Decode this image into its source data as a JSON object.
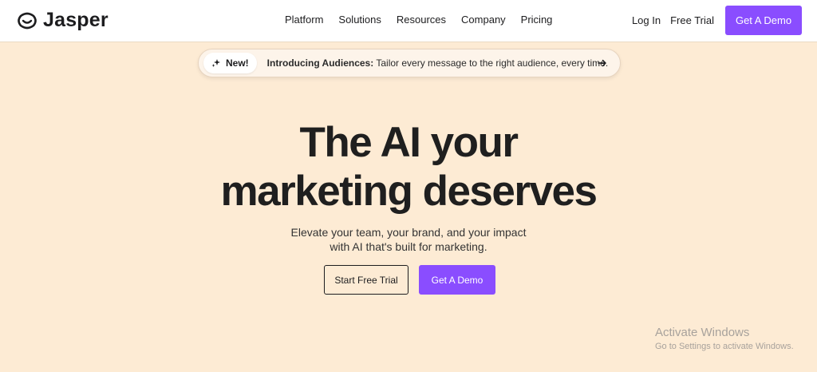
{
  "brand": {
    "name": "Jasper",
    "logo_icon": "smile-face-icon",
    "text_color": "#1d1d1f"
  },
  "nav": {
    "links": [
      "Platform",
      "Solutions",
      "Resources",
      "Company",
      "Pricing"
    ],
    "login_label": "Log In",
    "free_trial_label": "Free Trial",
    "demo_label": "Get A Demo"
  },
  "announcement": {
    "badge_label": "New!",
    "badge_icon": "sparkle-icon",
    "headline": "Introducing Audiences:",
    "text": "Tailor every message to the right audience, every time.",
    "arrow_icon": "arrow-right-icon"
  },
  "hero": {
    "title_line1": "The AI your",
    "title_line2": "marketing deserves",
    "subtitle_line1": "Elevate your team, your brand, and your impact",
    "subtitle_line2": "with AI that's built for marketing.",
    "free_trial_button": "Start Free Trial",
    "demo_button": "Get A Demo"
  },
  "watermark": {
    "title": "Activate Windows",
    "subtitle": "Go to Settings to activate Windows."
  },
  "colors": {
    "accent": "#8a4dff",
    "background": "#fdebd4",
    "navbar": "#ffffff",
    "text": "#1d1d1f"
  }
}
